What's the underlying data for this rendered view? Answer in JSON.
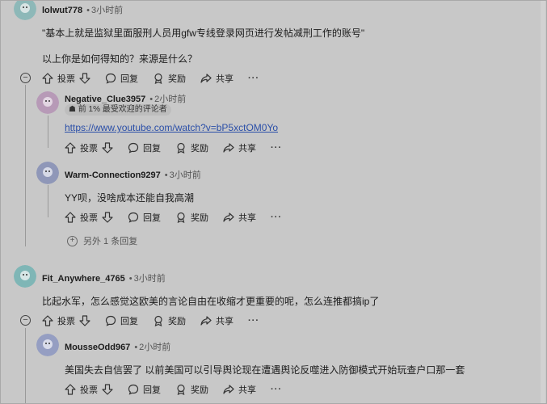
{
  "actions": {
    "upvote": "投票",
    "reply": "回复",
    "award": "奖励",
    "share": "共享",
    "more": "···"
  },
  "comments": {
    "c1": {
      "author": "lolwut778",
      "time": "3小时前",
      "line1": "\"基本上就是监狱里面服刑人员用gfw专线登录网页进行发帖减刑工作的账号\"",
      "line2": "以上你是如何得知的？来源是什么？"
    },
    "c2": {
      "author": "Negative_Clue3957",
      "time": "2小时前",
      "badge": "前 1% 最受欢迎的评论者",
      "link": "https://www.youtube.com/watch?v=bP5xctOM0Yo"
    },
    "c3": {
      "author": "Warm-Connection9297",
      "time": "3小时前",
      "text": "YY呗，没啥成本还能自我高潮",
      "more_replies": "另外 1 条回复"
    },
    "c4": {
      "author": "Fit_Anywhere_4765",
      "time": "3小时前",
      "text": "比起水军，怎么感觉这欧美的言论自由在收缩才更重要的呢，怎么连推都搞ip了"
    },
    "c5": {
      "author": "MousseOdd967",
      "time": "2小时前",
      "text": "美国失去自信罢了 以前美国可以引导舆论现在遭遇舆论反噬进入防御模式开始玩查户口那一套"
    }
  }
}
